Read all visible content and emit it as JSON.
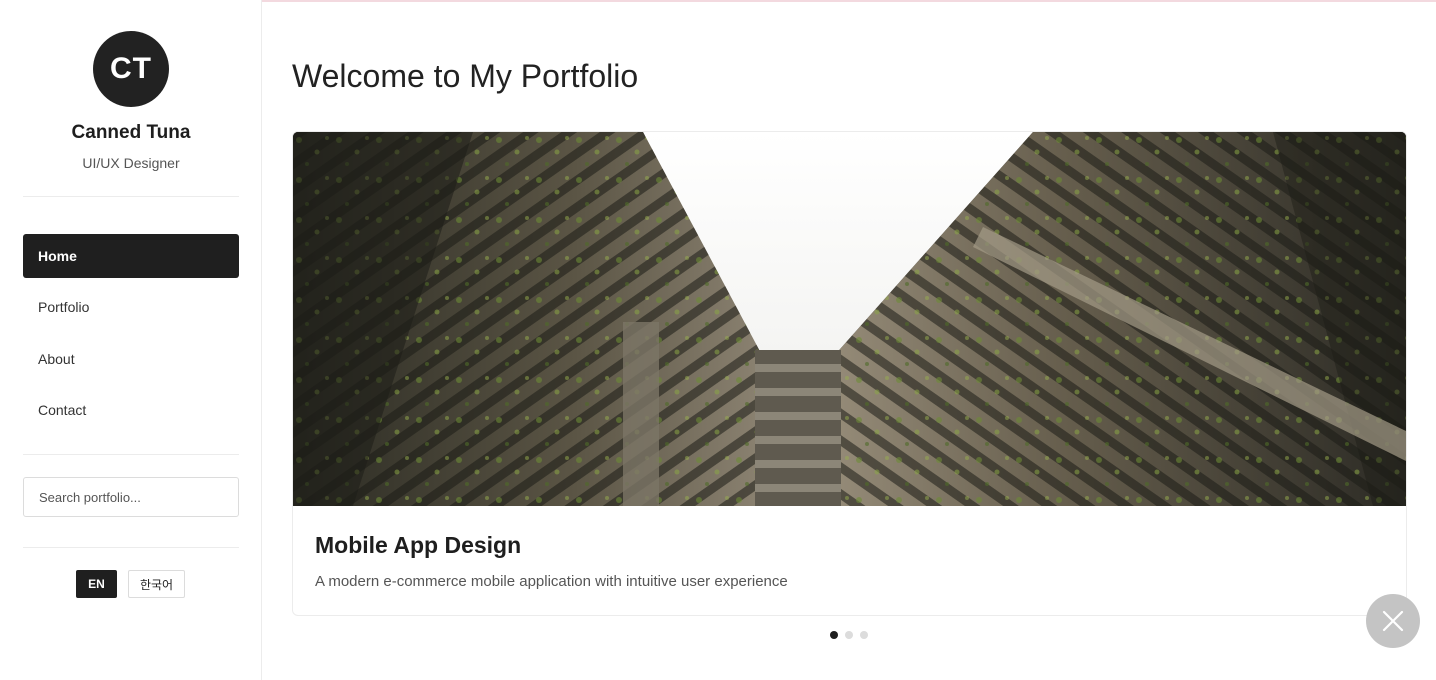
{
  "profile": {
    "initials": "CT",
    "name": "Canned Tuna",
    "role": "UI/UX Designer"
  },
  "nav": {
    "items": [
      {
        "label": "Home",
        "active": true
      },
      {
        "label": "Portfolio",
        "active": false
      },
      {
        "label": "About",
        "active": false
      },
      {
        "label": "Contact",
        "active": false
      }
    ]
  },
  "search": {
    "placeholder": "Search portfolio...",
    "value": ""
  },
  "languages": {
    "en": "EN",
    "ko": "한국어",
    "selected": "EN"
  },
  "main": {
    "title": "Welcome to My Portfolio",
    "carousel": {
      "current": 1,
      "total": 3,
      "slide": {
        "title": "Mobile App Design",
        "description": "A modern e-commerce mobile application with intuitive user experience"
      }
    }
  },
  "colors": {
    "accent": "#1f1f1f",
    "fab": "#c4c4c4"
  },
  "icons": {
    "close": "close-icon"
  }
}
